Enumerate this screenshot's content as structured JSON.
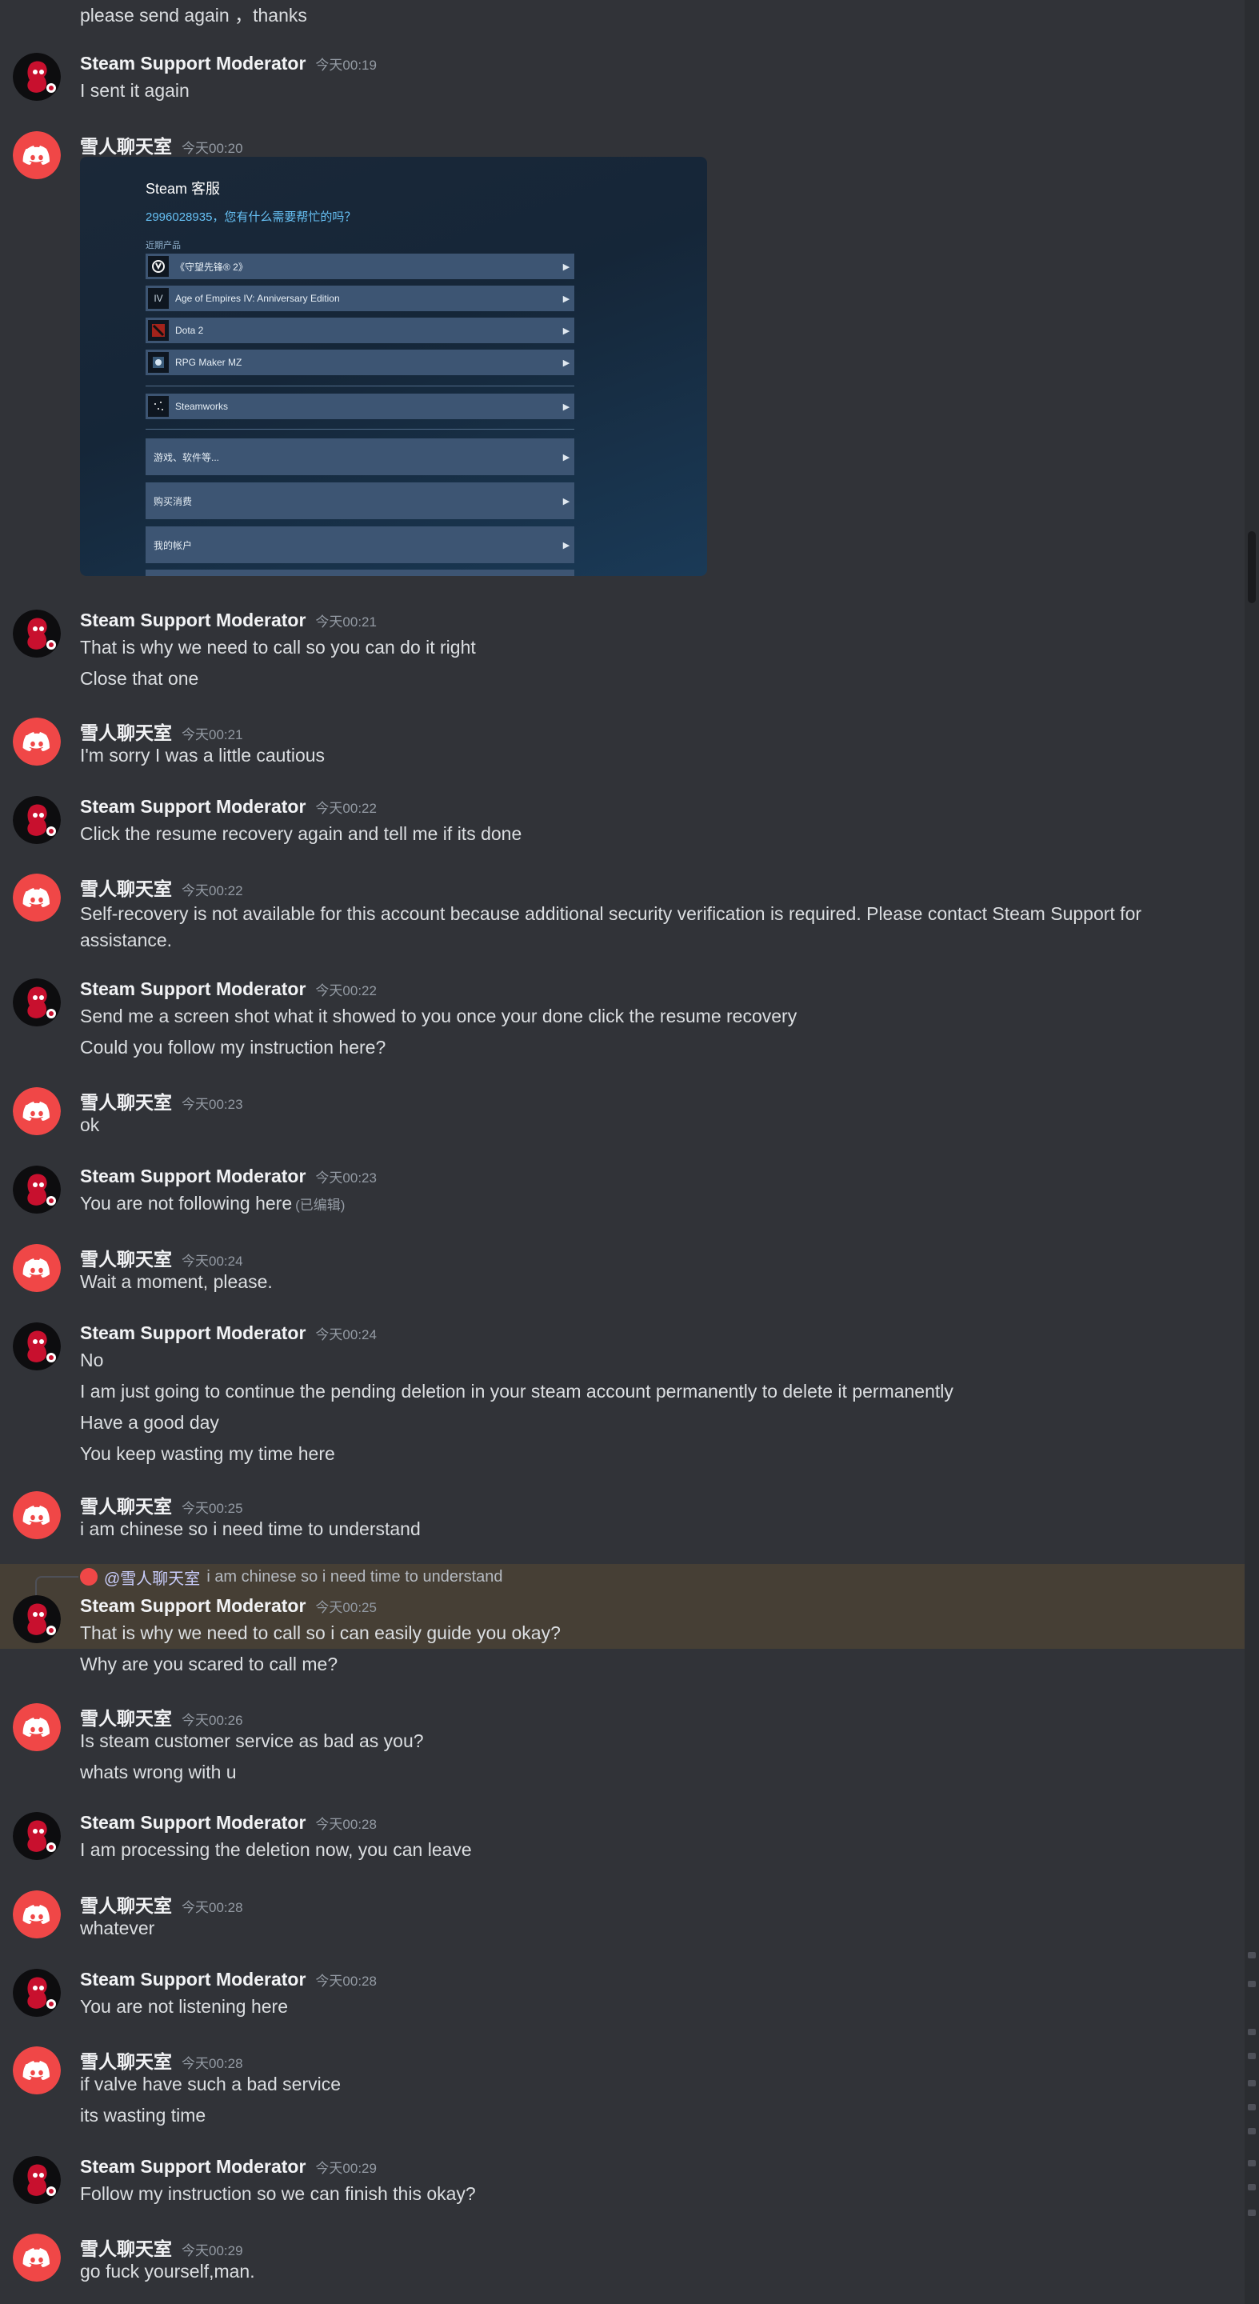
{
  "colors": {
    "background": "#313338",
    "highlight": "#463f35",
    "discord_red": "#f04747",
    "username": "#f2f3f5",
    "timestamp": "#949ba4"
  },
  "top_partial_text": "please send again ，thanks",
  "messages": [
    {
      "author": "Steam Support Moderator",
      "avatar": "red-character-avatar",
      "time": "今天00:19",
      "lines": [
        "I sent it again"
      ]
    },
    {
      "author": "雪人聊天室",
      "avatar": "discord-logo-avatar",
      "time": "今天00:20",
      "lines": []
    },
    {
      "author": "Steam Support Moderator",
      "avatar": "red-character-avatar",
      "time": "今天00:21",
      "lines": [
        "That is why we need to call so you can do it right",
        "Close that one"
      ]
    },
    {
      "author": "雪人聊天室",
      "avatar": "discord-logo-avatar",
      "time": "今天00:21",
      "lines": [
        "I'm sorry I was a little cautious"
      ]
    },
    {
      "author": "Steam Support Moderator",
      "avatar": "red-character-avatar",
      "time": "今天00:22",
      "lines": [
        "Click the resume recovery again and tell me if its done"
      ]
    },
    {
      "author": "雪人聊天室",
      "avatar": "discord-logo-avatar",
      "time": "今天00:22",
      "lines": [
        "Self-recovery is not available for this account because additional security verification is required. Please contact Steam Support for assistance."
      ]
    },
    {
      "author": "Steam Support Moderator",
      "avatar": "red-character-avatar",
      "time": "今天00:22",
      "lines": [
        "Send me a screen shot what it showed to you once your done click the resume recovery",
        "Could you follow my instruction here?"
      ]
    },
    {
      "author": "雪人聊天室",
      "avatar": "discord-logo-avatar",
      "time": "今天00:23",
      "lines": [
        "ok"
      ]
    },
    {
      "author": "Steam Support Moderator",
      "avatar": "red-character-avatar",
      "time": "今天00:23",
      "lines": [
        "You are not following here"
      ],
      "edited": "(已编辑)"
    },
    {
      "author": "雪人聊天室",
      "avatar": "discord-logo-avatar",
      "time": "今天00:24",
      "lines": [
        "Wait a moment, please."
      ]
    },
    {
      "author": "Steam Support Moderator",
      "avatar": "red-character-avatar",
      "time": "今天00:24",
      "lines": [
        "No",
        "I am just going to continue the pending deletion in your steam account permanently to delete it permanently",
        "Have a good day",
        "You keep wasting my time here"
      ]
    },
    {
      "author": "雪人聊天室",
      "avatar": "discord-logo-avatar",
      "time": "今天00:25",
      "lines": [
        "i am chinese so i need time to understand"
      ]
    },
    {
      "author": "Steam Support Moderator",
      "avatar": "red-character-avatar",
      "time": "今天00:25",
      "lines": [
        "That is why we need to call so i can easily guide you okay?",
        "Why are you scared to call me?"
      ]
    },
    {
      "author": "雪人聊天室",
      "avatar": "discord-logo-avatar",
      "time": "今天00:26",
      "lines": [
        "Is steam customer service as bad as you?",
        "whats wrong with u"
      ]
    },
    {
      "author": "Steam Support Moderator",
      "avatar": "red-character-avatar",
      "time": "今天00:28",
      "lines": [
        "I am processing the deletion now, you can leave"
      ]
    },
    {
      "author": "雪人聊天室",
      "avatar": "discord-logo-avatar",
      "time": "今天00:28",
      "lines": [
        "whatever"
      ]
    },
    {
      "author": "Steam Support Moderator",
      "avatar": "red-character-avatar",
      "time": "今天00:28",
      "lines": [
        "You are not listening here"
      ]
    },
    {
      "author": "雪人聊天室",
      "avatar": "discord-logo-avatar",
      "time": "今天00:28",
      "lines": [
        "if valve have such a bad service",
        "its wasting time"
      ]
    },
    {
      "author": "Steam Support Moderator",
      "avatar": "red-character-avatar",
      "time": "今天00:29",
      "lines": [
        "Follow my instruction so we can finish this okay?"
      ]
    },
    {
      "author": "雪人聊天室",
      "avatar": "discord-logo-avatar",
      "time": "今天00:29",
      "lines": [
        "go fuck yourself,man."
      ]
    }
  ],
  "reply": {
    "mention": "@雪人聊天室",
    "text": "i am chinese so i need time to understand"
  },
  "embedded_image": {
    "title": "Steam 客服",
    "subtitle": "2996028935，您有什么需要帮忙的吗？",
    "section": "近期产品",
    "products": [
      {
        "label": "《守望先锋® 2》",
        "icon": "overwatch-icon"
      },
      {
        "label": "Age of Empires IV: Anniversary Edition",
        "icon": "aoe-icon",
        "icon_text": "IV"
      },
      {
        "label": "Dota 2",
        "icon": "dota-icon"
      },
      {
        "label": "RPG Maker MZ",
        "icon": "rpgmaker-icon"
      }
    ],
    "steamworks": "Steamworks",
    "menu": [
      "游戏、软件等...",
      "购买消费",
      "我的帐户"
    ]
  }
}
